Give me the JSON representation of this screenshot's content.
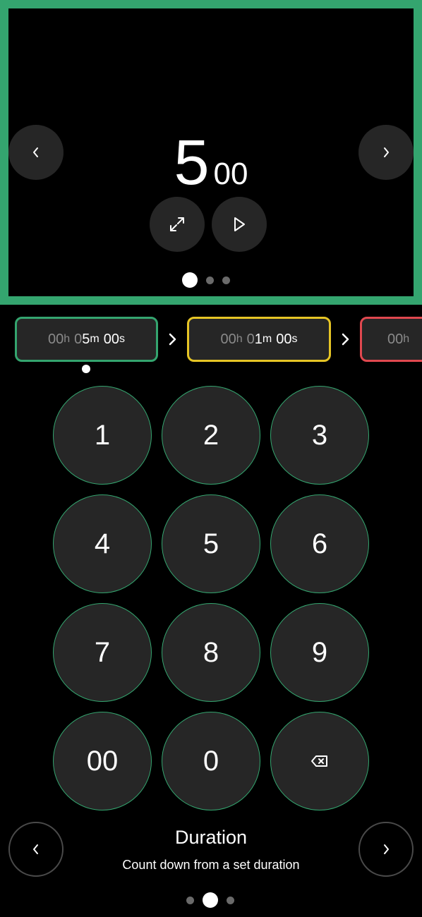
{
  "preview": {
    "minutes": "5",
    "seconds": "00",
    "page_dots": 3,
    "active_dot": 0
  },
  "steps": [
    {
      "h": "00",
      "h_unit": "h",
      "m_dim": "0",
      "m": "5",
      "m_unit": "m",
      "s": "00",
      "s_unit": "s",
      "color": "#34a56f"
    },
    {
      "h": "00",
      "h_unit": "h",
      "m_dim": "0",
      "m": "1",
      "m_unit": "m",
      "s": "00",
      "s_unit": "s",
      "color": "#e6c525"
    },
    {
      "h": "00",
      "h_unit": "h",
      "color": "#e0484f"
    }
  ],
  "keypad": {
    "keys": [
      "1",
      "2",
      "3",
      "4",
      "5",
      "6",
      "7",
      "8",
      "9",
      "00",
      "0"
    ],
    "delete_icon": "backspace-icon"
  },
  "mode": {
    "title": "Duration",
    "description": "Count down from a set duration",
    "page_dots": 3,
    "active_dot": 1
  },
  "icons": {
    "prev": "chevron-left-icon",
    "next": "chevron-right-icon",
    "fullscreen": "expand-icon",
    "play": "play-icon"
  },
  "colors": {
    "accent": "#34a56f",
    "warning": "#e6c525",
    "danger": "#e0484f",
    "button": "#262626"
  }
}
